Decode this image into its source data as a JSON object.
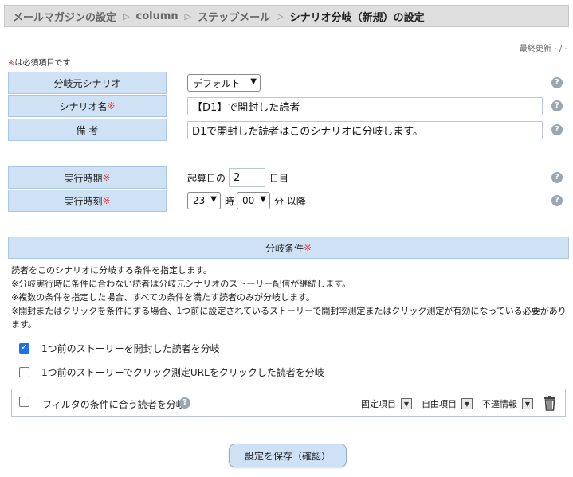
{
  "breadcrumb": {
    "items": [
      "メールマガジンの設定",
      "column",
      "ステップメール"
    ],
    "current": "シナリオ分岐（新規）の設定",
    "separator": "▷"
  },
  "last_updated": "最終更新 - / -",
  "required_note": {
    "mark": "※",
    "text": "は必須項目です"
  },
  "form": {
    "source_scenario": {
      "label": "分岐元シナリオ",
      "value": "デフォルト"
    },
    "scenario_name": {
      "label": "シナリオ名",
      "required": "※",
      "value": "【D1】で開封した読者"
    },
    "memo": {
      "label": "備 考",
      "value": "D1で開封した読者はこのシナリオに分岐します。"
    },
    "exec_day": {
      "label": "実行時期",
      "required": "※",
      "prefix": "起算日の",
      "value": "2",
      "suffix": "日目"
    },
    "exec_time": {
      "label": "実行時刻",
      "required": "※",
      "hour": "23",
      "hour_unit": "時",
      "minute": "00",
      "minute_unit": "分 以降"
    }
  },
  "branch": {
    "title": "分岐条件",
    "required": "※",
    "description": [
      "読者をこのシナリオに分岐する条件を指定します。",
      "※分岐実行時に条件に合わない読者は分岐元シナリオのストーリー配信が継続します。",
      "※複数の条件を指定した場合、すべての条件を満たす読者のみが分岐します。",
      "※開封またはクリックを条件にする場合、1つ前に設定されているストーリーで開封率測定またはクリック測定が有効になっている必要があります。"
    ],
    "options": [
      {
        "label": "1つ前のストーリーを開封した読者を分岐",
        "checked": true
      },
      {
        "label": "1つ前のストーリーでクリック測定URLをクリックした読者を分岐",
        "checked": false
      }
    ],
    "filter": {
      "label": "フィルタの条件に合う読者を分岐",
      "checked": false,
      "dropdowns": [
        "固定項目",
        "自由項目",
        "不達情報"
      ]
    }
  },
  "save_button": "設定を保存（確認）",
  "icons": {
    "help": "help-icon",
    "chevron": "chevron-down-icon",
    "trash": "trash-icon",
    "check": "check-icon"
  },
  "colors": {
    "label_bg": "#cfe2f5",
    "required": "#e0393e",
    "checkbox": "#1a73e8"
  }
}
